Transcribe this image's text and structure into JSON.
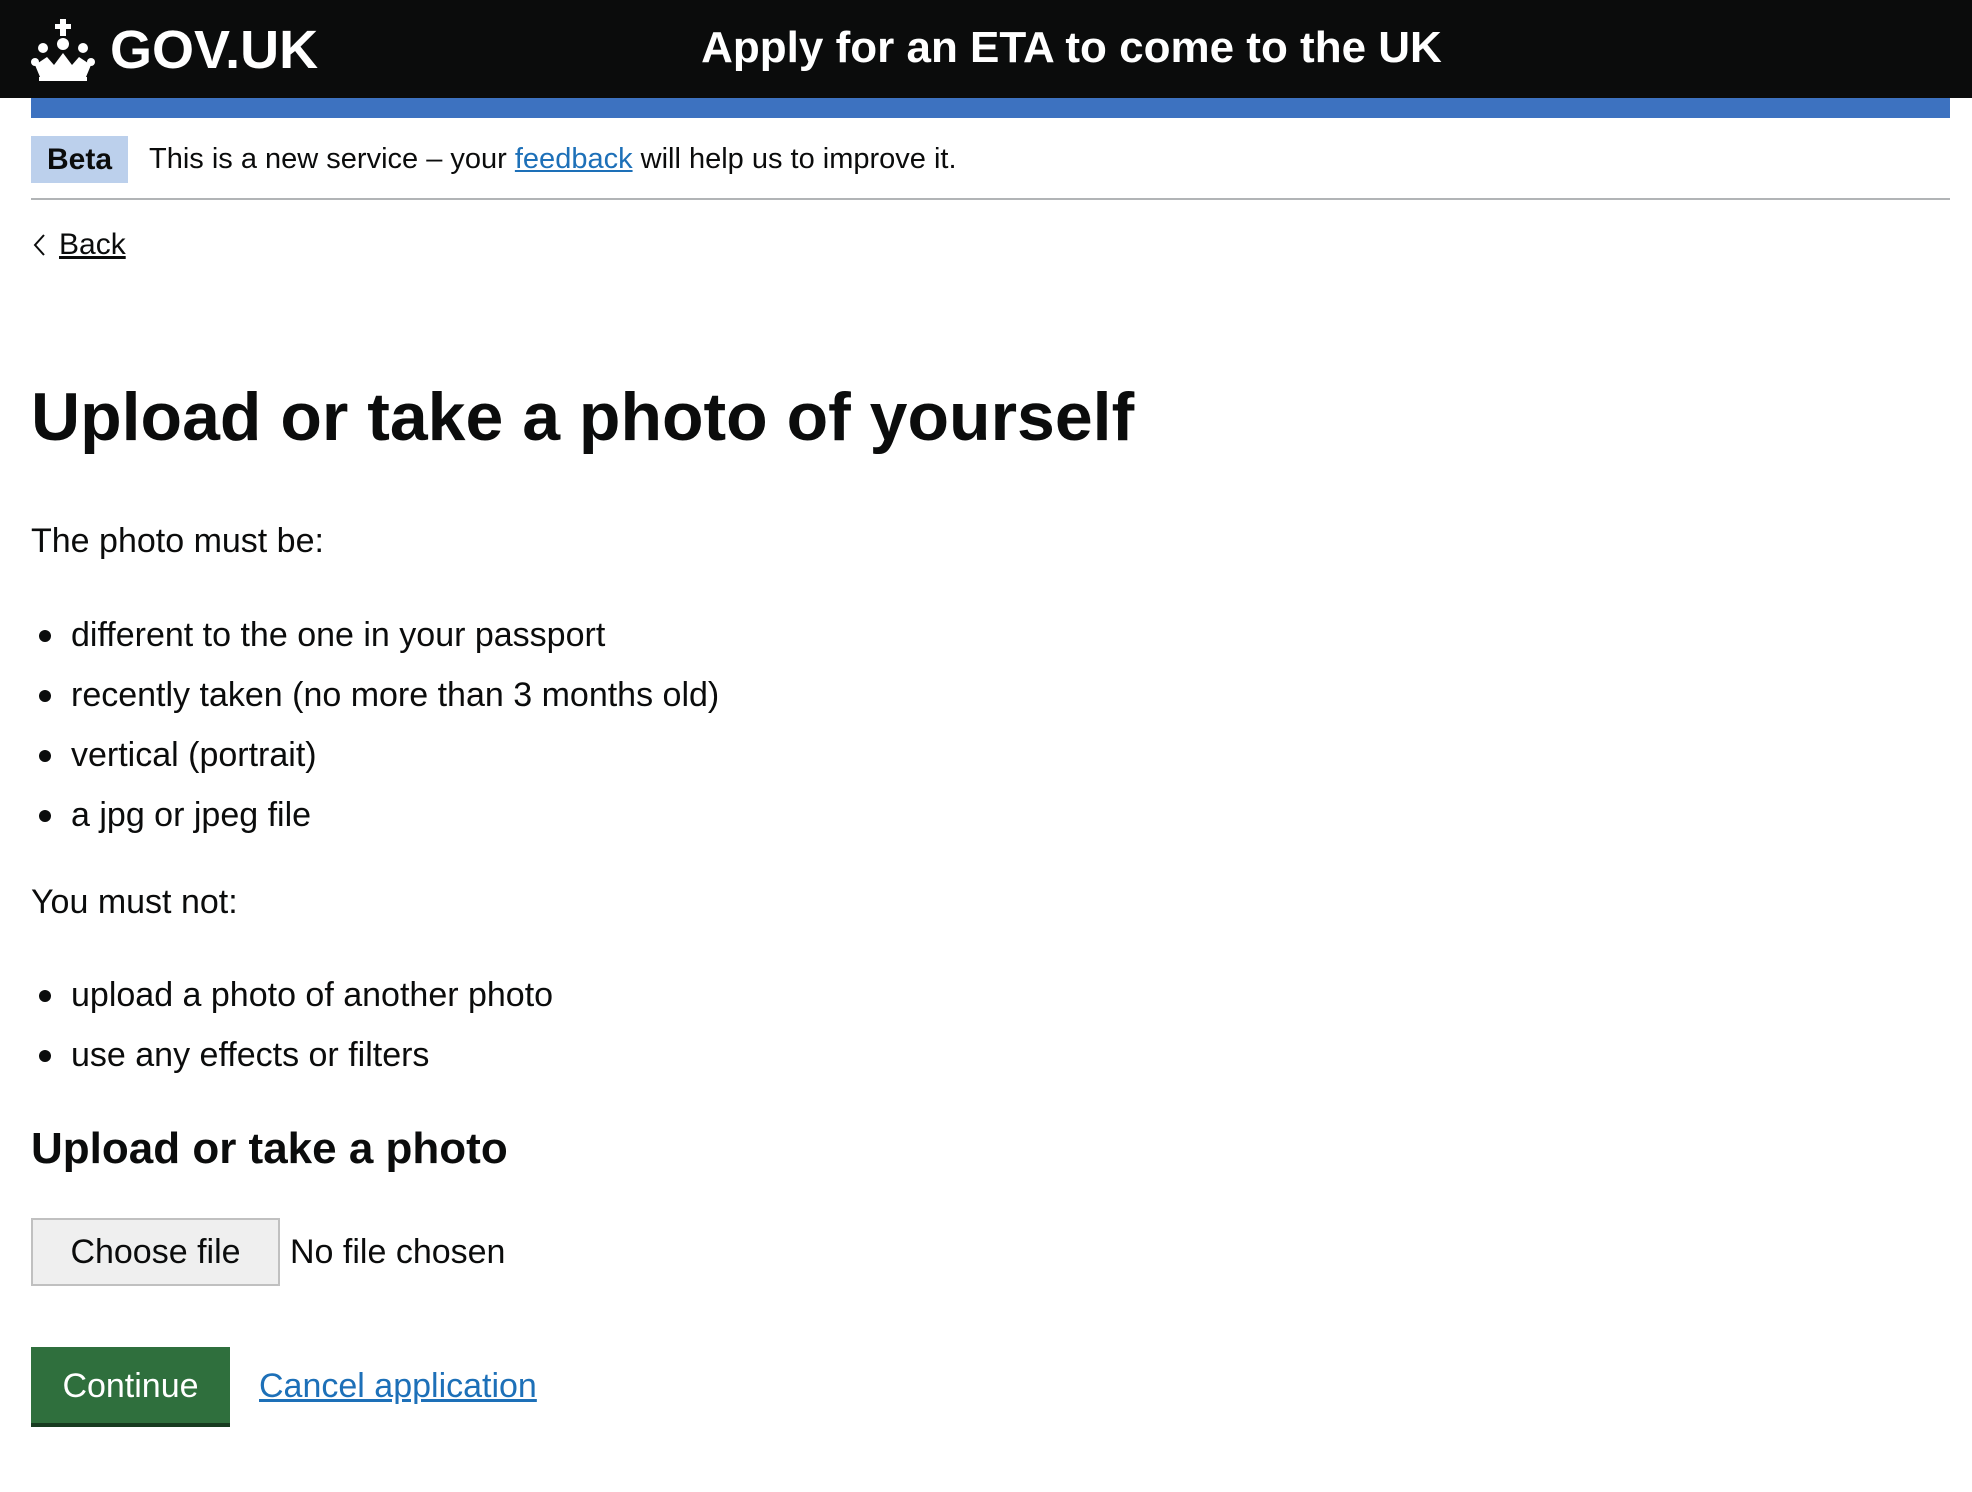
{
  "header": {
    "logo_text": "GOV.UK",
    "service_name": "Apply for an ETA to come to the UK",
    "background_color": "#0b0c0c",
    "accent_color": "#3d72c0",
    "logo_icon": "crown-icon"
  },
  "phase_banner": {
    "tag": "Beta",
    "text_before": "This is a new service – your",
    "link_text": "feedback",
    "text_after": "will help us to improve it."
  },
  "back_link": {
    "label": "Back",
    "icon": "chevron-left-icon"
  },
  "main": {
    "heading": "Upload or take a photo of yourself",
    "requirements_intro": "The photo must be:",
    "requirements": [
      "different to the one in your passport",
      "recently taken (no more than 3 months old)",
      "vertical (portrait)",
      "a jpg or jpeg file"
    ],
    "restrictions_intro": "You must not:",
    "restrictions": [
      "upload a photo of another photo",
      "use any effects or filters"
    ],
    "upload_heading": "Upload or take a photo",
    "file_input": {
      "button_label": "Choose file",
      "status": "No file chosen"
    },
    "continue_label": "Continue",
    "cancel_label": "Cancel application",
    "continue_color": "#2f6f3d",
    "link_color": "#1d70b8"
  }
}
